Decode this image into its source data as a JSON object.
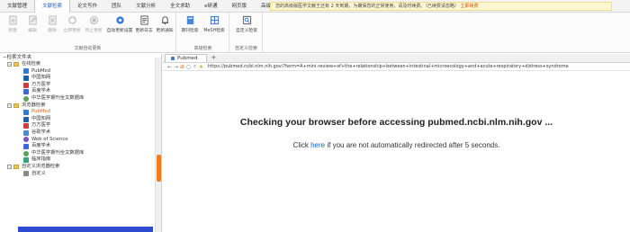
{
  "menubar": {
    "tabs": [
      "文献管理",
      "文献检索",
      "论文写作",
      "团队",
      "文献分析",
      "全文求助",
      "e研通",
      "网页版",
      "高级版续费"
    ],
    "active_index": 1
  },
  "notice": {
    "text": "您的高级版医学文献王还有 2 天到期，为确保您的正常使用，请及时续费。（已续费请忽略）",
    "link": "立即续费"
  },
  "ribbon": {
    "groups": [
      {
        "title": "文献自动更新",
        "buttons": [
          {
            "label": "新建",
            "icon": "new-icon",
            "disabled": true
          },
          {
            "label": "编辑",
            "icon": "edit-icon",
            "disabled": true
          },
          {
            "label": "删除",
            "icon": "delete-icon",
            "disabled": true
          },
          {
            "label": "立即更新",
            "icon": "refresh-icon",
            "disabled": true
          },
          {
            "label": "停止更新",
            "icon": "stop-icon",
            "disabled": true
          },
          {
            "label": "自动更新设置",
            "icon": "settings-icon",
            "disabled": false
          },
          {
            "label": "更新日志",
            "icon": "log-icon",
            "disabled": false
          },
          {
            "label": "更新通知",
            "icon": "bell-icon",
            "disabled": false
          }
        ]
      },
      {
        "title": "高级检索",
        "buttons": [
          {
            "label": "期刊检索",
            "icon": "journal-icon",
            "disabled": false
          },
          {
            "label": "MeSH检索",
            "icon": "mesh-icon",
            "disabled": false
          }
        ]
      },
      {
        "title": "自定义检索",
        "buttons": [
          {
            "label": "自定义检索",
            "icon": "custom-search-icon",
            "disabled": false
          }
        ]
      }
    ]
  },
  "tree": {
    "root_label": "检索文件夹",
    "folders": [
      {
        "label": "在线检索",
        "items": [
          {
            "label": "PubMed",
            "color": "#2e7bd1"
          },
          {
            "label": "中国知网",
            "color": "#1b5fa8"
          },
          {
            "label": "万方医学",
            "color": "#d23b3b"
          },
          {
            "label": "百度学术",
            "color": "#3a68d8"
          },
          {
            "label": "中华医学期刊全文数据库",
            "color": "#59a35a"
          }
        ]
      },
      {
        "label": "浏览器检索",
        "items": [
          {
            "label": "PubMed",
            "color": "#2e7bd1",
            "selected": true
          },
          {
            "label": "中国知网",
            "color": "#1b5fa8"
          },
          {
            "label": "万方医学",
            "color": "#d23b3b"
          },
          {
            "label": "谷歌学术",
            "color": "#4a8ad8"
          },
          {
            "label": "Web of Science",
            "color": "#7a52b5"
          },
          {
            "label": "百度学术",
            "color": "#3a68d8"
          },
          {
            "label": "中华医学期刊全文数据库",
            "color": "#59a35a"
          },
          {
            "label": "临床指南",
            "color": "#2aa87a"
          }
        ]
      },
      {
        "label": "自定义浏览器检索",
        "items": [
          {
            "label": "自定义",
            "color": "#888888"
          }
        ]
      }
    ]
  },
  "browser": {
    "tab_label": "Pubmed",
    "add_tab": "+",
    "url": "https://pubmed.ncbi.nlm.nih.gov/?term=A+mini-review+of+the+relationship+between+intestinal+microecology+and+acute+respiratory+distress+syndrome",
    "heading": "Checking your browser before accessing pubmed.ncbi.nlm.nih.gov ...",
    "sub_before": "Click ",
    "sub_link": "here",
    "sub_after": " if you are not automatically redirected after 5 seconds."
  }
}
